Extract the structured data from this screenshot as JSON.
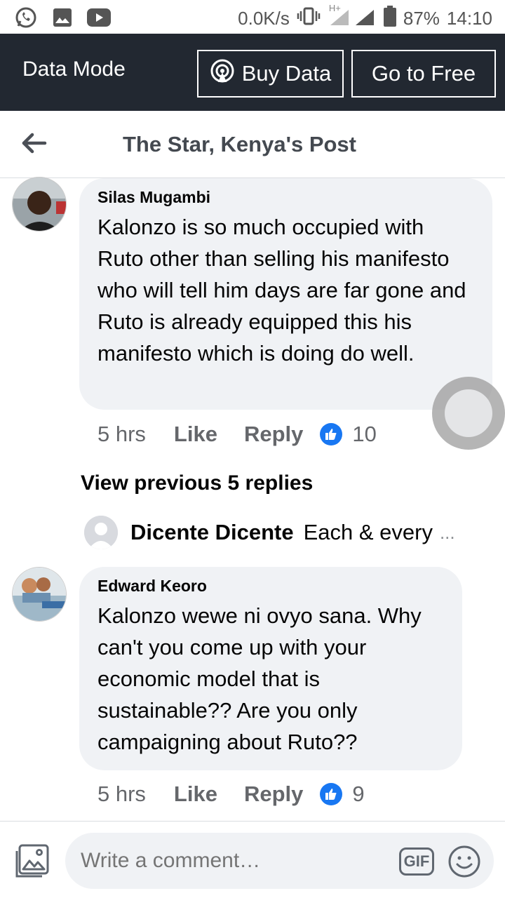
{
  "status_bar": {
    "net_speed": "0.0K/s",
    "network_type": "H+",
    "battery": "87%",
    "time": "14:10",
    "left_icons": [
      "whatsapp-icon",
      "gallery-icon",
      "youtube-icon"
    ]
  },
  "data_bar": {
    "mode_label": "Data Mode",
    "buy_data_label": "Buy Data",
    "go_free_label": "Go to Free"
  },
  "header": {
    "title": "The Star, Kenya's Post"
  },
  "comments": [
    {
      "author": "Silas Mugambi",
      "text": "Kalonzo is so much occupied with Ruto  other than selling his manifesto who will tell him days are far gone and Ruto is already equipped this his manifesto which is doing do well.",
      "time": "5 hrs",
      "like_label": "Like",
      "reply_label": "Reply",
      "reactions": "10"
    },
    {
      "author": "Edward Keoro",
      "text": "Kalonzo wewe ni ovyo sana. Why can't you come up with your economic model that is sustainable?? Are you only campaigning about Ruto??",
      "time": "5 hrs",
      "like_label": "Like",
      "reply_label": "Reply",
      "reactions": "9"
    }
  ],
  "replies": {
    "view_previous": "View previous 5 replies",
    "latest_author": "Dicente Dicente",
    "latest_text": "Each & every",
    "ellipsis": "..."
  },
  "composer": {
    "placeholder": "Write a comment…",
    "gif_label": "GIF"
  },
  "colors": {
    "data_bar_bg": "#222831",
    "bubble_bg": "#f0f2f5",
    "like_blue": "#1877f2"
  }
}
